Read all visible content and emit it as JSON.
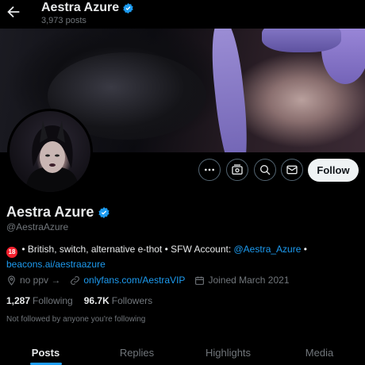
{
  "header": {
    "display_name": "Aestra Azure",
    "post_count": "3,973 posts"
  },
  "profile": {
    "display_name": "Aestra Azure",
    "handle": "@AestraAzure",
    "bio": {
      "age_badge": "18",
      "text": " • British, switch, alternative e-thot • SFW Account: ",
      "sfw_link": "@Aestra_Azure",
      "separator": " •",
      "website": "beacons.ai/aestraazure"
    },
    "location": "no ppv →",
    "link": "onlyfans.com/AestraVIP",
    "joined": "Joined March 2021",
    "following_count": "1,287",
    "following_label": "Following",
    "followers_count": "96.7K",
    "followers_label": "Followers",
    "not_followed_note": "Not followed by anyone you're following"
  },
  "actions": {
    "follow_label": "Follow"
  },
  "tabs": [
    {
      "label": "Posts",
      "active": true
    },
    {
      "label": "Replies",
      "active": false
    },
    {
      "label": "Highlights",
      "active": false
    },
    {
      "label": "Media",
      "active": false
    }
  ],
  "colors": {
    "accent": "#1d9bf0",
    "background": "#000000",
    "text_primary": "#e7e9ea",
    "text_secondary": "#71767b"
  },
  "icons": {
    "back": "arrow-left-icon",
    "verified": "verified-badge-icon",
    "more": "more-horizontal-icon",
    "subscriptions": "subscriptions-icon",
    "search": "search-icon",
    "message": "envelope-icon",
    "location": "location-pin-icon",
    "link": "link-icon",
    "calendar": "calendar-icon"
  }
}
